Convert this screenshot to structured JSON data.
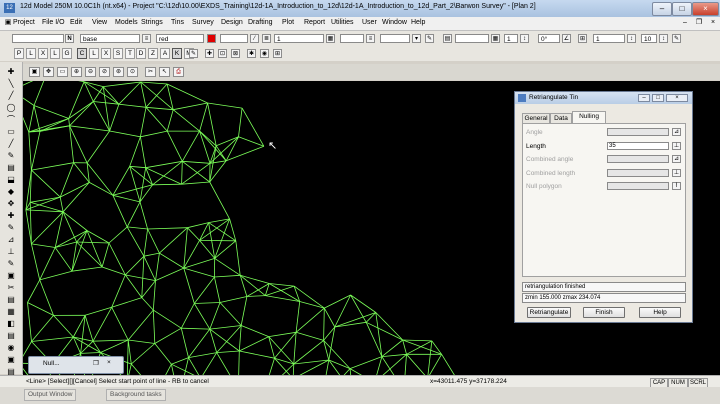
{
  "window": {
    "title": "12d Model 250M 10.0C1h (nt.x64) - Project \"C:\\12d\\10.00\\EXDS_Training\\12d-1A_Introduction_to_12d\\12d-1A_Introduction_to_12d_Part_2\\Barwon Survey\" - [Plan 2]"
  },
  "menu": [
    "Project",
    "File I/O",
    "Edit",
    "View",
    "Models",
    "Strings",
    "Tins",
    "Survey",
    "Design",
    "Drafting",
    "Plot",
    "Report",
    "Utilities",
    "User",
    "Window",
    "Help"
  ],
  "toolbar": {
    "model_value": "base",
    "color_value": "red",
    "color_hex": "#e00000",
    "weight_value": "1",
    "field_1": "1",
    "field_angle": "0°",
    "field_2": "1",
    "field_text_size": "10",
    "letters": [
      "P",
      "L",
      "X",
      "L",
      "G",
      "C",
      "L",
      "X",
      "S",
      "T",
      "D",
      "Z",
      "A",
      "K",
      "M"
    ]
  },
  "dialog": {
    "title": "Retriangulate Tin",
    "tabs": [
      "General",
      "Data",
      "Nulling"
    ],
    "fields": [
      {
        "label": "Angle",
        "value": "",
        "enabled": false
      },
      {
        "label": "Length",
        "value": "35",
        "enabled": true
      },
      {
        "label": "Combined angle",
        "value": "",
        "enabled": false
      },
      {
        "label": "Combined length",
        "value": "",
        "enabled": false
      },
      {
        "label": "Null polygon",
        "value": "",
        "enabled": false
      }
    ],
    "message": "retriangulation finished",
    "zrange": "zmin 155.000 zmax 234.074",
    "buttons": {
      "retriangulate": "Retriangulate",
      "finish": "Finish",
      "help": "Help"
    }
  },
  "mini_panel": {
    "label": "Null..."
  },
  "status": {
    "prompt": "<Line> [Select][][Cancel] Select start point of line - RB to cancel",
    "coords": "x=43011.475 y=37178.224",
    "indicators": [
      "CAP",
      "NUM",
      "SCRL"
    ]
  },
  "bottom_tabs": [
    "Output Window",
    "Background tasks"
  ],
  "colors": {
    "tin_lines": "#7cff5a",
    "canvas": "#000000"
  }
}
